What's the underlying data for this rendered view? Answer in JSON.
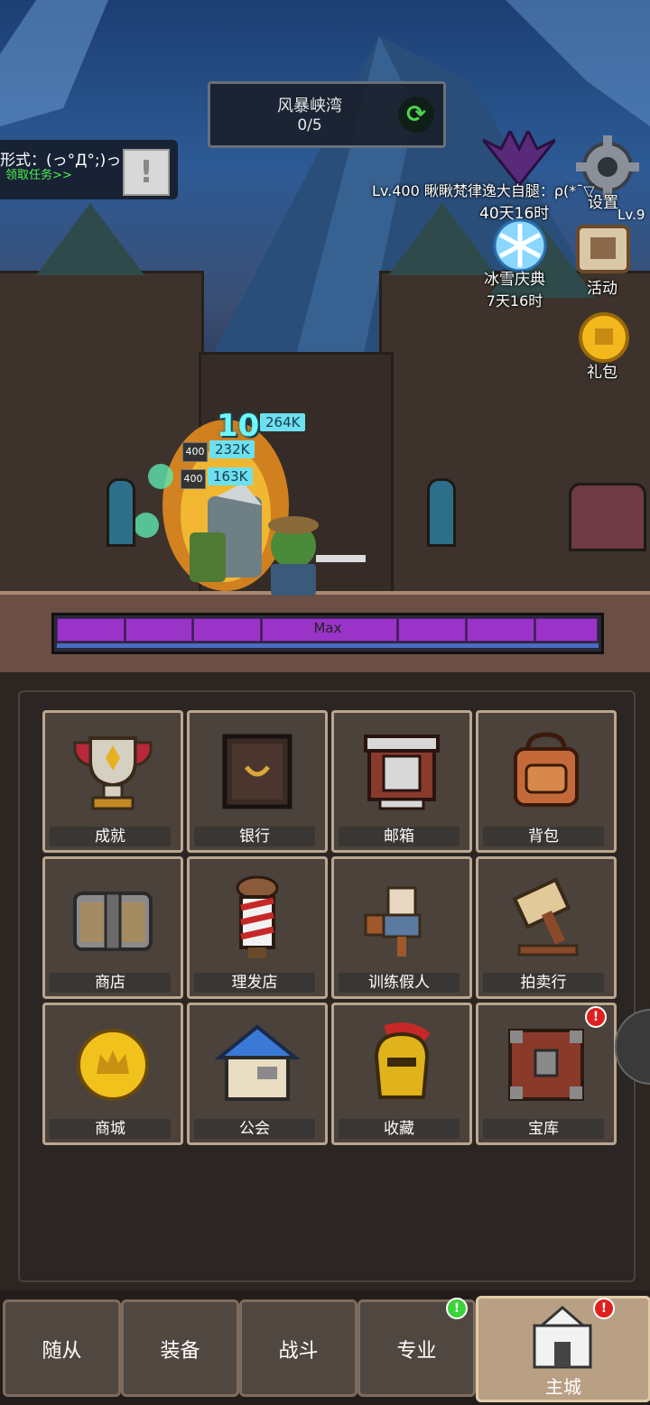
{
  "stage": {
    "name": "风暴峡湾",
    "progress": "0/5"
  },
  "quest": {
    "title": "形式：(っ°Д°;)っ",
    "link": "领取任务>>",
    "alert": "!"
  },
  "player": {
    "line": "Lv.400 瞅瞅梵律逸大自腿：ρ(*ˉ▽",
    "level_right": "Lv.9"
  },
  "side_icons": {
    "event1": {
      "label": "40天16时"
    },
    "settings": {
      "label": "设置"
    },
    "snow": {
      "label": "冰雪庆典",
      "timer": "7天16时"
    },
    "activity": {
      "label": "活动"
    },
    "gift": {
      "label": "礼包"
    }
  },
  "combat": {
    "combo": "10",
    "damage": [
      "264K",
      "232K",
      "163K"
    ],
    "levels": [
      "400",
      "400"
    ],
    "hp_label": "Max"
  },
  "menu": [
    {
      "label": "成就"
    },
    {
      "label": "银行"
    },
    {
      "label": "邮箱"
    },
    {
      "label": "背包"
    },
    {
      "label": "商店"
    },
    {
      "label": "理发店"
    },
    {
      "label": "训练假人"
    },
    {
      "label": "拍卖行"
    },
    {
      "label": "商城"
    },
    {
      "label": "公会"
    },
    {
      "label": "收藏"
    },
    {
      "label": "宝库"
    }
  ],
  "nav": [
    {
      "label": "随从"
    },
    {
      "label": "装备"
    },
    {
      "label": "战斗"
    },
    {
      "label": "专业"
    },
    {
      "label": "主城"
    }
  ],
  "badges": {
    "red": "!",
    "green": "!"
  },
  "colors": {
    "hp_fill": "#9a33c8",
    "damage_tag": "#6de0f0",
    "accent_green": "#4ef24e"
  }
}
